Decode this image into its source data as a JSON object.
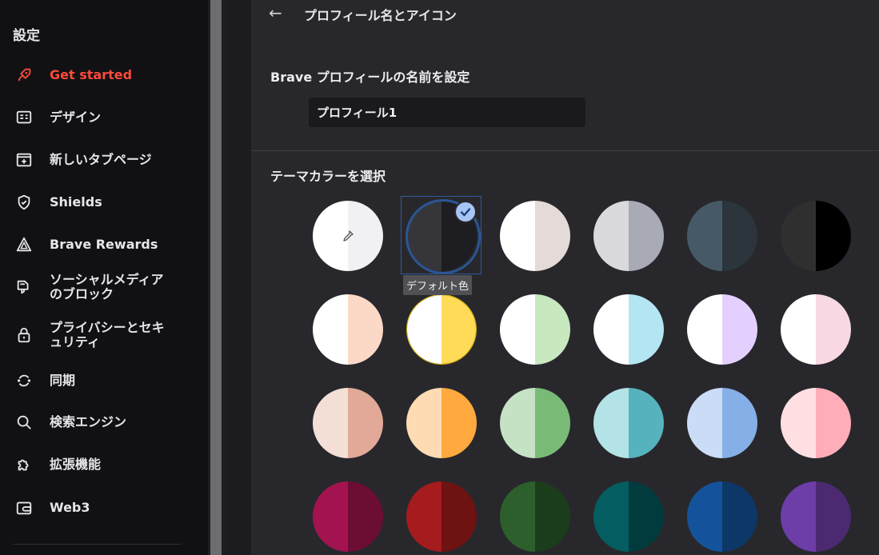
{
  "sidebar": {
    "title": "設定",
    "items": [
      {
        "label": "Get started",
        "icon": "rocket-icon",
        "active": true
      },
      {
        "label": "デザイン",
        "icon": "appearance-icon"
      },
      {
        "label": "新しいタブページ",
        "icon": "new-tab-icon"
      },
      {
        "label": "Shields",
        "icon": "shield-icon"
      },
      {
        "label": "Brave Rewards",
        "icon": "rewards-triangle-icon"
      },
      {
        "label": "ソーシャルメディア\nのブロック",
        "icon": "thumbs-down-icon"
      },
      {
        "label": "プライバシーとセキ\nュリティ",
        "icon": "lock-icon"
      },
      {
        "label": "同期",
        "icon": "sync-icon"
      },
      {
        "label": "検索エンジン",
        "icon": "search-icon"
      },
      {
        "label": "拡張機能",
        "icon": "puzzle-icon"
      },
      {
        "label": "Web3",
        "icon": "wallet-icon"
      }
    ]
  },
  "main": {
    "back_icon": "←",
    "page_title": "プロフィール名とアイコン",
    "name_heading": "Brave プロフィールの名前を設定",
    "name_input_value": "プロフィール1",
    "theme_heading": "テーマカラーを選択",
    "tooltip": "デフォルト色",
    "accent_active": "#ff4a3d",
    "selected_index": 1,
    "swatches": [
      [
        "#ffffff",
        "#f1f1f3"
      ],
      [
        "#36363a",
        "#1e1e22"
      ],
      [
        "#ffffff",
        "#e4dad8"
      ],
      [
        "#d9d9de",
        "#a8abb6"
      ],
      [
        "#455a66",
        "#2b353b"
      ],
      [
        "#2f2f2f",
        "#000000"
      ],
      [
        "#ffffff",
        "#fbd9c6"
      ],
      [
        "#ffffff",
        "#ffdb57"
      ],
      [
        "#ffffff",
        "#c8e8c0"
      ],
      [
        "#ffffff",
        "#b3e6f2"
      ],
      [
        "#ffffff",
        "#e4d0fe"
      ],
      [
        "#ffffff",
        "#f7d8e3"
      ],
      [
        "#f4dfd7",
        "#e2a898"
      ],
      [
        "#ffdbb4",
        "#ffa93f"
      ],
      [
        "#c5e3c4",
        "#79ba77"
      ],
      [
        "#b3e3e6",
        "#56b3bd"
      ],
      [
        "#cbdcf6",
        "#86afe8"
      ],
      [
        "#ffdfe2",
        "#ffadb8"
      ],
      [
        "#a3134f",
        "#6c0d33"
      ],
      [
        "#a51b1e",
        "#6e1212"
      ],
      [
        "#2c5f2c",
        "#1c3d1c"
      ],
      [
        "#045d60",
        "#023b3d"
      ],
      [
        "#14539c",
        "#0c3766"
      ],
      [
        "#6d3da8",
        "#4b2a72"
      ]
    ]
  }
}
